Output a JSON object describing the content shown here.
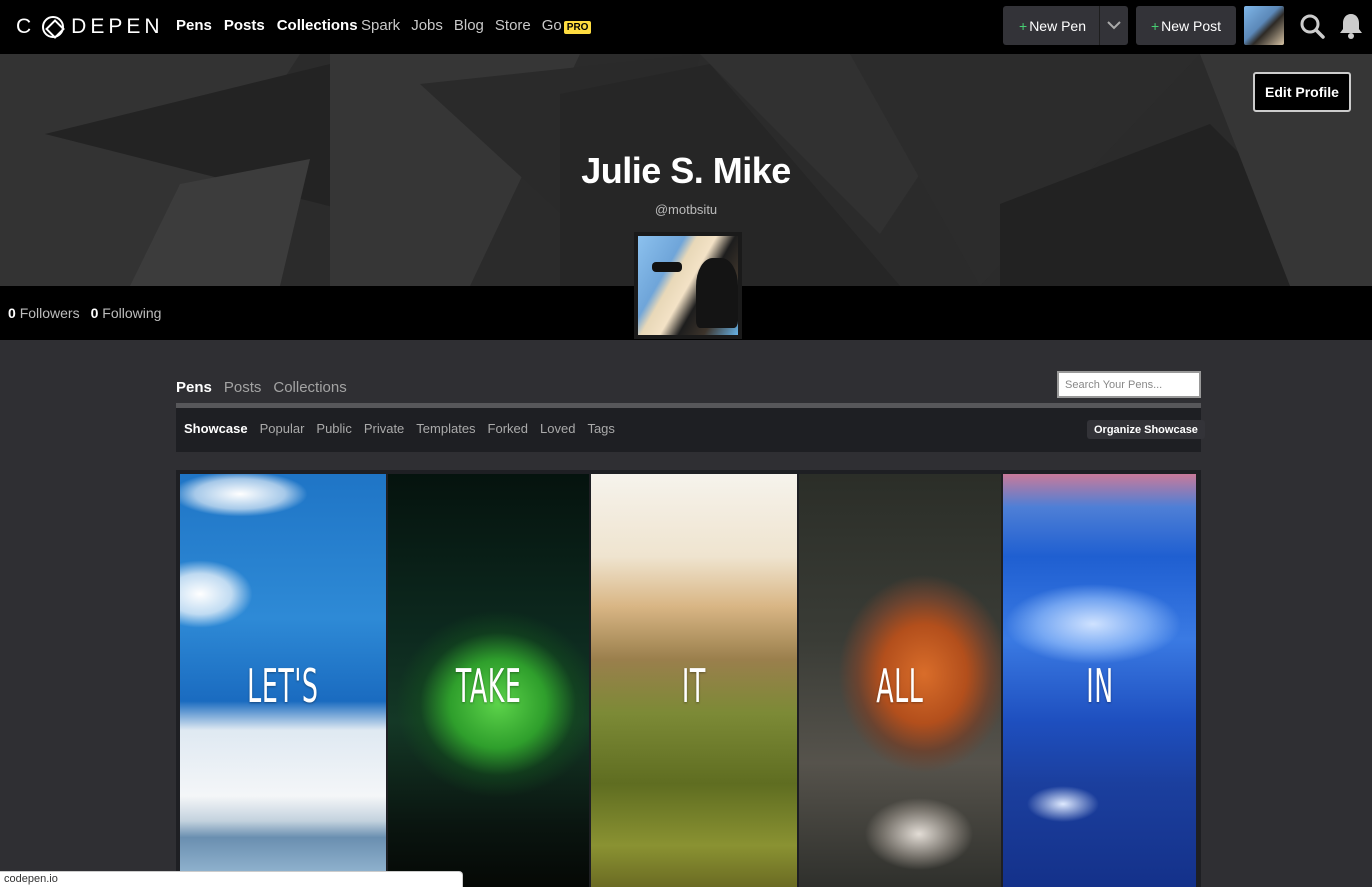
{
  "nav": {
    "logo": "CODEPEN",
    "main_links": [
      "Pens",
      "Posts",
      "Collections"
    ],
    "secondary_links": [
      "Spark",
      "Jobs",
      "Blog",
      "Store"
    ],
    "go_label": "Go",
    "pro_badge": "PRO",
    "new_pen": "New Pen",
    "new_post": "New Post",
    "plus": "+"
  },
  "profile": {
    "name": "Julie S. Mike",
    "handle": "@motbsitu",
    "edit_button": "Edit Profile",
    "followers_count": "0",
    "followers_label": "Followers",
    "following_count": "0",
    "following_label": "Following"
  },
  "content": {
    "tabs": [
      "Pens",
      "Posts",
      "Collections"
    ],
    "active_tab": "Pens",
    "search_placeholder": "Search Your Pens...",
    "subtabs": [
      "Showcase",
      "Popular",
      "Public",
      "Private",
      "Templates",
      "Forked",
      "Loved",
      "Tags"
    ],
    "active_subtab": "Showcase",
    "organize_button": "Organize Showcase"
  },
  "showcase": {
    "words": [
      "LET'S",
      "TAKE",
      "IT",
      "ALL",
      "IN"
    ]
  },
  "status_bar": {
    "url": "codepen.io"
  },
  "colors": {
    "accent_green": "#47cf73",
    "pro_yellow": "#ffdd40",
    "background": "#2f2f33",
    "topbar": "#000000"
  },
  "icons": [
    "codepen-logo-icon",
    "chevron-down-icon",
    "search-icon",
    "bell-icon"
  ]
}
